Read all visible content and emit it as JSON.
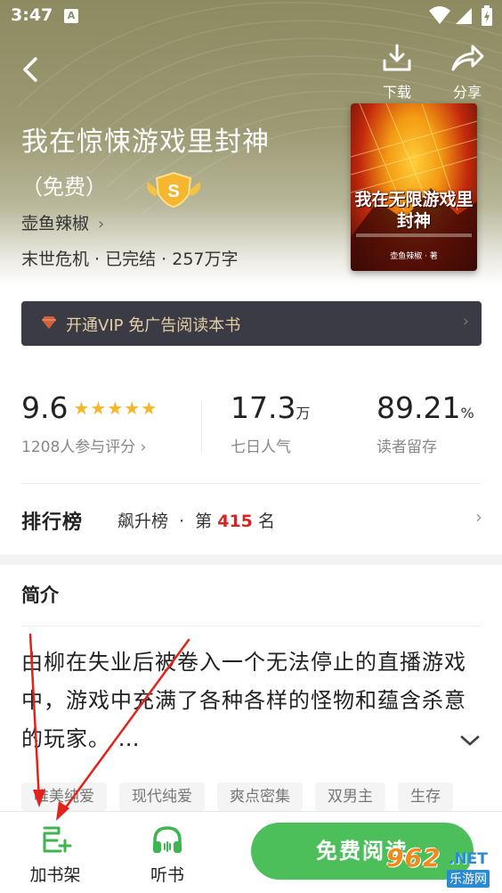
{
  "status_bar": {
    "time": "3:47",
    "notif_letter": "A"
  },
  "header": {
    "download_label": "下载",
    "share_label": "分享"
  },
  "book": {
    "title": "我在惊悚游戏里封神",
    "subtitle": "（免费）",
    "author": "壶鱼辣椒",
    "meta": "末世危机 · 已完结 · 257万字",
    "vip_badge_letter": "S",
    "cover": {
      "title_line1": "我在无限游戏里",
      "title_line2": "封神",
      "author": "壶鱼辣椒 · 著"
    }
  },
  "vip_bar": {
    "text": "开通VIP 免广告阅读本书"
  },
  "stats": {
    "rating": {
      "value": "9.6",
      "stars": 5,
      "label": "1208人参与评分 ›"
    },
    "popularity": {
      "value": "17.3",
      "unit": "万",
      "label": "七日人气"
    },
    "retention": {
      "value": "89.21",
      "unit": "%",
      "label": "读者留存"
    }
  },
  "ranking": {
    "title_a": "排",
    "title_b": "行榜",
    "list_name": "飙升榜",
    "sep": "·",
    "rank_prefix": "第",
    "rank_number": "415",
    "rank_suffix": "名"
  },
  "intro": {
    "title": "简介",
    "text": "由柳在失业后被卷入一个无法停止的直播游戏中，游戏中充满了各种各样的怪物和蕴含杀意的玩家。 …"
  },
  "tags": [
    "唯美纯爱",
    "现代纯爱",
    "爽点密集",
    "双男主",
    "生存"
  ],
  "bottom_bar": {
    "shelf_label": "加书架",
    "listen_label": "听书",
    "read_label": "免费阅读"
  },
  "watermark": {
    "num": "962",
    "net": ".NET",
    "cn": "乐游网"
  },
  "colors": {
    "hero": "#8d8a61",
    "accent_green": "#4cbf5a",
    "star": "#f7b52a",
    "rank_red": "#d9241f",
    "vip_bar": "#3b3b45",
    "vip_text": "#e2cfa6"
  }
}
